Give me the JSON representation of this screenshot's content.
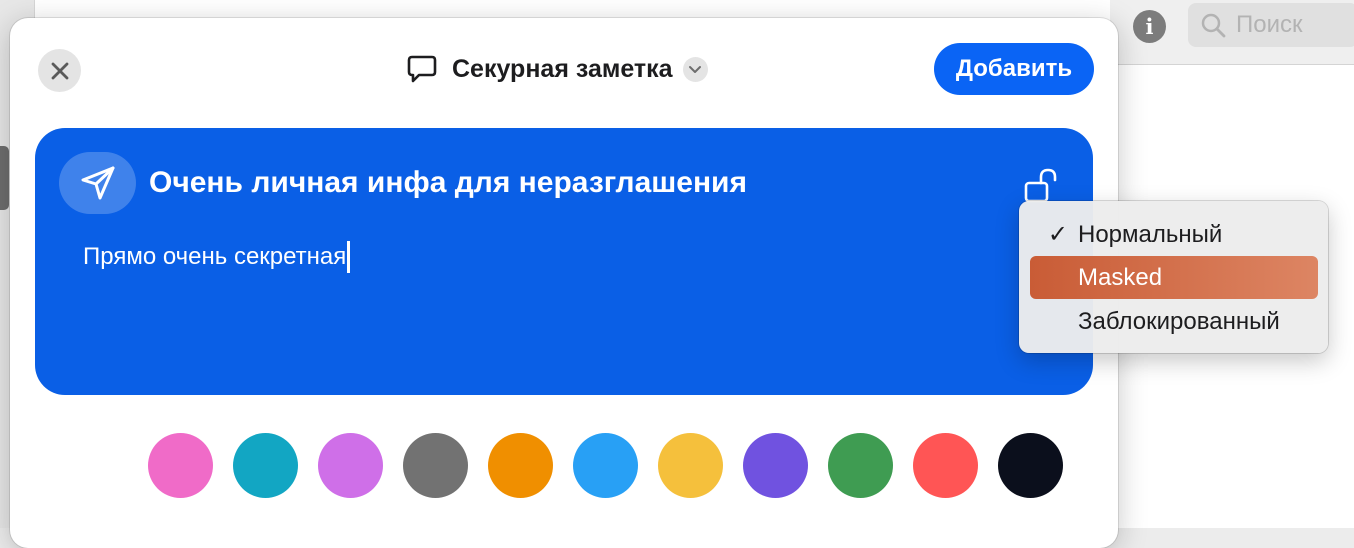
{
  "background": {
    "search_placeholder": "Поиск",
    "info_icon": "info-circle-icon"
  },
  "sheet": {
    "title": "Секурная заметка",
    "title_icon": "speech-bubble-icon",
    "close_icon": "close-icon",
    "add_button": "Добавить"
  },
  "note": {
    "icon": "paper-plane-icon",
    "title": "Очень личная инфа для неразглашения",
    "body": "Прямо очень секретная",
    "lock_icon": "lock-open-icon",
    "background_color": "#0a5fe6"
  },
  "palette": {
    "colors": [
      "#f06bc8",
      "#12a6c3",
      "#cf6fe8",
      "#727272",
      "#f08f00",
      "#28a0f5",
      "#f5c03c",
      "#7052e0",
      "#3f9c52",
      "#ff5555",
      "#0b0f1c"
    ]
  },
  "menu": {
    "items": [
      {
        "label": "Нормальный",
        "check": "✓",
        "checked": true,
        "highlighted": false
      },
      {
        "label": "Masked",
        "check": "",
        "checked": false,
        "highlighted": true
      },
      {
        "label": "Заблокированный",
        "check": "",
        "checked": false,
        "highlighted": false
      }
    ]
  }
}
